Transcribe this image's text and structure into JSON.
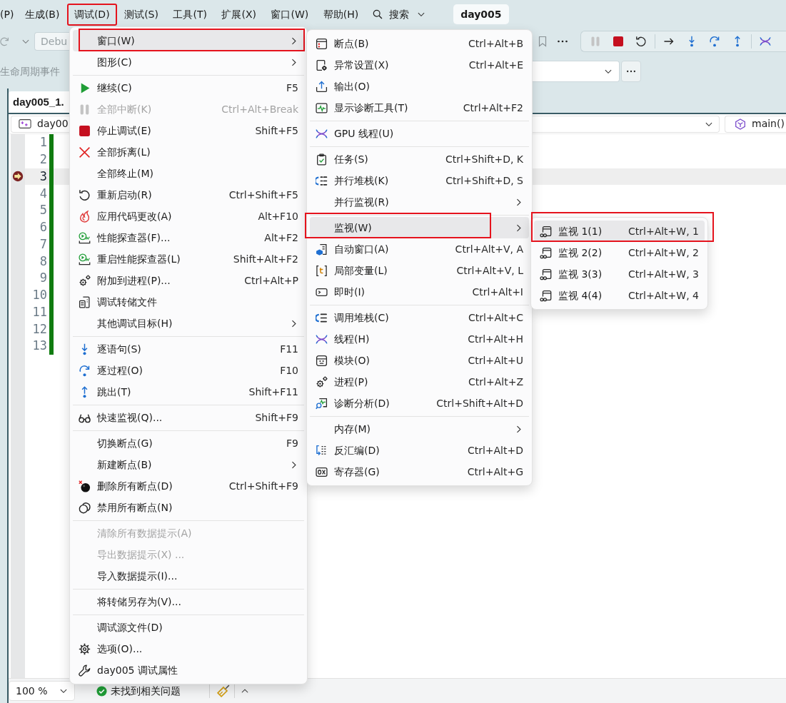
{
  "menu_bar": {
    "items": [
      {
        "label": "(P)",
        "annotated": false
      },
      {
        "label": "生成(B)",
        "annotated": false
      },
      {
        "label": "调试(D)",
        "annotated": true
      },
      {
        "label": "测试(S)",
        "annotated": false
      },
      {
        "label": "工具(T)",
        "annotated": false
      },
      {
        "label": "扩展(X)",
        "annotated": false
      },
      {
        "label": "窗口(W)",
        "annotated": false
      },
      {
        "label": "帮助(H)",
        "annotated": false
      }
    ],
    "search": {
      "label": "搜索"
    },
    "solution_name": "day005"
  },
  "toolbar": {
    "configuration": "Debu"
  },
  "event_bar": {
    "label": "生命周期事件"
  },
  "document_tab": {
    "title": "day005_1."
  },
  "navigation_bar": {
    "project": "day00",
    "function": "main()"
  },
  "editor": {
    "lines": [
      {
        "number": "1",
        "current": false
      },
      {
        "number": "2",
        "current": false
      },
      {
        "number": "3",
        "current": true
      },
      {
        "number": "4",
        "current": false
      },
      {
        "number": "5",
        "current": false
      },
      {
        "number": "6",
        "current": false
      },
      {
        "number": "7",
        "current": false
      },
      {
        "number": "8",
        "current": false
      },
      {
        "number": "9",
        "current": false
      },
      {
        "number": "10",
        "current": false
      },
      {
        "number": "11",
        "current": false
      },
      {
        "number": "12",
        "current": false
      },
      {
        "number": "13",
        "current": false
      }
    ]
  },
  "status_bar": {
    "zoom": "100 %",
    "issues": "未找到相关问题"
  },
  "debug_menu": {
    "groups": [
      {
        "items": [
          {
            "label": "窗口(W)",
            "submenu": true,
            "disabled": false,
            "selected": true,
            "annotated": true
          },
          {
            "label": "图形(C)",
            "submenu": true,
            "disabled": false,
            "selected": false,
            "annotated": false
          }
        ]
      },
      {
        "items": [
          {
            "label": "继续(C)",
            "shortcut": "F5",
            "disabled": false,
            "selected": false,
            "annotated": false
          },
          {
            "label": "全部中断(K)",
            "shortcut": "Ctrl+Alt+Break",
            "disabled": true,
            "selected": false,
            "annotated": false
          },
          {
            "label": "停止调试(E)",
            "shortcut": "Shift+F5",
            "disabled": false,
            "selected": false,
            "annotated": false
          },
          {
            "label": "全部拆离(L)",
            "disabled": false,
            "selected": false,
            "annotated": false
          },
          {
            "label": "全部终止(M)",
            "disabled": false,
            "selected": false,
            "annotated": false
          },
          {
            "label": "重新启动(R)",
            "shortcut": "Ctrl+Shift+F5",
            "disabled": false,
            "selected": false,
            "annotated": false
          },
          {
            "label": "应用代码更改(A)",
            "shortcut": "Alt+F10",
            "disabled": false,
            "selected": false,
            "annotated": false
          },
          {
            "label": "性能探查器(F)...",
            "shortcut": "Alt+F2",
            "disabled": false,
            "selected": false,
            "annotated": false
          },
          {
            "label": "重启性能探查器(L)",
            "shortcut": "Shift+Alt+F2",
            "disabled": false,
            "selected": false,
            "annotated": false
          },
          {
            "label": "附加到进程(P)...",
            "shortcut": "Ctrl+Alt+P",
            "disabled": false,
            "selected": false,
            "annotated": false
          },
          {
            "label": "调试转储文件",
            "disabled": false,
            "selected": false,
            "annotated": false
          },
          {
            "label": "其他调试目标(H)",
            "submenu": true,
            "disabled": false,
            "selected": false,
            "annotated": false
          }
        ]
      },
      {
        "items": [
          {
            "label": "逐语句(S)",
            "shortcut": "F11",
            "disabled": false,
            "selected": false,
            "annotated": false
          },
          {
            "label": "逐过程(O)",
            "shortcut": "F10",
            "disabled": false,
            "selected": false,
            "annotated": false
          },
          {
            "label": "跳出(T)",
            "shortcut": "Shift+F11",
            "disabled": false,
            "selected": false,
            "annotated": false
          }
        ]
      },
      {
        "items": [
          {
            "label": "快速监视(Q)...",
            "shortcut": "Shift+F9",
            "disabled": false,
            "selected": false,
            "annotated": false
          }
        ]
      },
      {
        "items": [
          {
            "label": "切换断点(G)",
            "shortcut": "F9",
            "disabled": false,
            "selected": false,
            "annotated": false
          },
          {
            "label": "新建断点(B)",
            "submenu": true,
            "disabled": false,
            "selected": false,
            "annotated": false
          },
          {
            "label": "删除所有断点(D)",
            "shortcut": "Ctrl+Shift+F9",
            "disabled": false,
            "selected": false,
            "annotated": false
          },
          {
            "label": "禁用所有断点(N)",
            "disabled": false,
            "selected": false,
            "annotated": false
          }
        ]
      },
      {
        "items": [
          {
            "label": "清除所有数据提示(A)",
            "disabled": true,
            "selected": false,
            "annotated": false
          },
          {
            "label": "导出数据提示(X) ...",
            "disabled": true,
            "selected": false,
            "annotated": false
          },
          {
            "label": "导入数据提示(I)...",
            "disabled": false,
            "selected": false,
            "annotated": false
          }
        ]
      },
      {
        "items": [
          {
            "label": "将转储另存为(V)...",
            "disabled": false,
            "selected": false,
            "annotated": false
          }
        ]
      },
      {
        "items": [
          {
            "label": "调试源文件(D)",
            "disabled": false,
            "selected": false,
            "annotated": false
          },
          {
            "label": "选项(O)...",
            "disabled": false,
            "selected": false,
            "annotated": false
          },
          {
            "label": "day005 调试属性",
            "disabled": false,
            "selected": false,
            "annotated": false
          }
        ]
      }
    ]
  },
  "window_submenu": {
    "groups": [
      {
        "items": [
          {
            "label": "断点(B)",
            "shortcut": "Ctrl+Alt+B",
            "disabled": false,
            "selected": false,
            "annotated": false
          },
          {
            "label": "异常设置(X)",
            "shortcut": "Ctrl+Alt+E",
            "disabled": false,
            "selected": false,
            "annotated": false
          },
          {
            "label": "输出(O)",
            "disabled": false,
            "selected": false,
            "annotated": false
          },
          {
            "label": "显示诊断工具(T)",
            "shortcut": "Ctrl+Alt+F2",
            "disabled": false,
            "selected": false,
            "annotated": false
          }
        ]
      },
      {
        "items": [
          {
            "label": "GPU 线程(U)",
            "disabled": false,
            "selected": false,
            "annotated": false
          }
        ]
      },
      {
        "items": [
          {
            "label": "任务(S)",
            "shortcut": "Ctrl+Shift+D, K",
            "disabled": false,
            "selected": false,
            "annotated": false
          },
          {
            "label": "并行堆栈(K)",
            "shortcut": "Ctrl+Shift+D, S",
            "disabled": false,
            "selected": false,
            "annotated": false
          },
          {
            "label": "并行监视(R)",
            "submenu": true,
            "disabled": false,
            "selected": false,
            "annotated": false
          }
        ]
      },
      {
        "items": [
          {
            "label": "监视(W)",
            "submenu": true,
            "disabled": false,
            "selected": true,
            "annotated": true
          },
          {
            "label": "自动窗口(A)",
            "shortcut": "Ctrl+Alt+V, A",
            "disabled": false,
            "selected": false,
            "annotated": false
          },
          {
            "label": "局部变量(L)",
            "shortcut": "Ctrl+Alt+V, L",
            "disabled": false,
            "selected": false,
            "annotated": false
          },
          {
            "label": "即时(I)",
            "shortcut": "Ctrl+Alt+I",
            "disabled": false,
            "selected": false,
            "annotated": false
          }
        ]
      },
      {
        "items": [
          {
            "label": "调用堆栈(C)",
            "shortcut": "Ctrl+Alt+C",
            "disabled": false,
            "selected": false,
            "annotated": false
          },
          {
            "label": "线程(H)",
            "shortcut": "Ctrl+Alt+H",
            "disabled": false,
            "selected": false,
            "annotated": false
          },
          {
            "label": "模块(O)",
            "shortcut": "Ctrl+Alt+U",
            "disabled": false,
            "selected": false,
            "annotated": false
          },
          {
            "label": "进程(P)",
            "shortcut": "Ctrl+Alt+Z",
            "disabled": false,
            "selected": false,
            "annotated": false
          },
          {
            "label": "诊断分析(D)",
            "shortcut": "Ctrl+Shift+Alt+D",
            "disabled": false,
            "selected": false,
            "annotated": false
          }
        ]
      },
      {
        "items": [
          {
            "label": "内存(M)",
            "submenu": true,
            "disabled": false,
            "selected": false,
            "annotated": false
          },
          {
            "label": "反汇编(D)",
            "shortcut": "Ctrl+Alt+D",
            "disabled": false,
            "selected": false,
            "annotated": false
          },
          {
            "label": "寄存器(G)",
            "shortcut": "Ctrl+Alt+G",
            "disabled": false,
            "selected": false,
            "annotated": false
          }
        ]
      }
    ]
  },
  "watch_submenu": {
    "items": [
      {
        "label": "监视 1(1)",
        "shortcut": "Ctrl+Alt+W, 1",
        "disabled": false,
        "selected": true,
        "annotated": true
      },
      {
        "label": "监视 2(2)",
        "shortcut": "Ctrl+Alt+W, 2",
        "disabled": false,
        "selected": false,
        "annotated": false
      },
      {
        "label": "监视 3(3)",
        "shortcut": "Ctrl+Alt+W, 3",
        "disabled": false,
        "selected": false,
        "annotated": false
      },
      {
        "label": "监视 4(4)",
        "shortcut": "Ctrl+Alt+W, 4",
        "disabled": false,
        "selected": false,
        "annotated": false
      }
    ]
  }
}
